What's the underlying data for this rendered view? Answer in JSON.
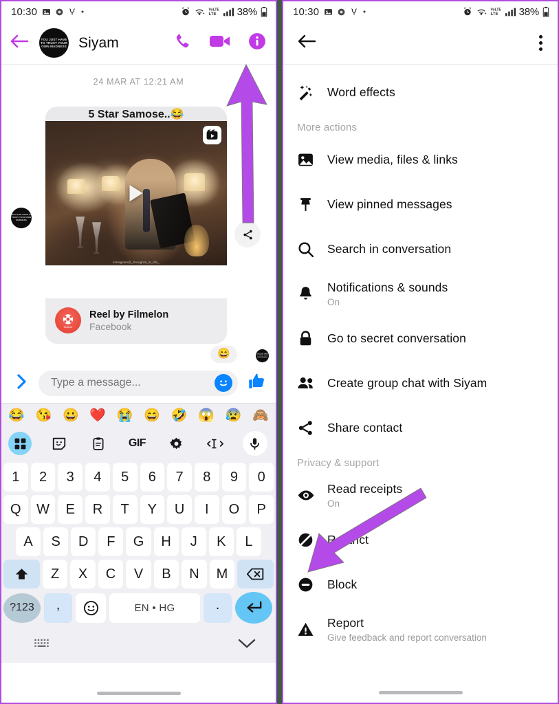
{
  "status_bar": {
    "time": "10:30",
    "battery_text": "38%",
    "network_label": "LTE",
    "volte_label": "VoLTE",
    "left_icons": [
      "photo-icon",
      "settings-gear-icon",
      "alarm-plug-icon",
      "dot-icon"
    ],
    "right_icons": [
      "alarm-clock-icon",
      "wifi-icon",
      "volte-icon",
      "signal-bars-icon",
      "battery-icon"
    ]
  },
  "left_panel": {
    "header": {
      "back_label": "Back",
      "contact_name": "Siyam",
      "avatar_text": "YOU JUST HAVE TO TRUST YOUR OWN MADNESS",
      "actions": [
        {
          "name": "audio-call-button",
          "icon": "phone-icon"
        },
        {
          "name": "video-call-button",
          "icon": "video-camera-icon"
        },
        {
          "name": "conversation-info-button",
          "icon": "info-icon"
        }
      ]
    },
    "conversation": {
      "timestamp": "24 MAR AT 12:21 AM",
      "message_caption": "5 Star Samose..",
      "message_caption_emoji": "😂",
      "media_credit": "instagram@_thoughts_in_life_",
      "reel_badge": "reel-icon",
      "attachment": {
        "title": "Reel by Filmelon",
        "subtitle": "Facebook",
        "logo_label": "filmelon"
      },
      "reaction_emoji": "😄",
      "share_icon": "share-icon"
    },
    "composer": {
      "expand_icon": "chevron-right-icon",
      "placeholder": "Type a message...",
      "value": "",
      "emoji_icon": "smiley-icon",
      "like_icon": "thumbs-up-icon"
    },
    "emoji_strip": [
      "😂",
      "😘",
      "😀",
      "❤️",
      "😭",
      "😄",
      "🤣",
      "😱",
      "😰",
      "🙈"
    ],
    "keyboard_toolbar": [
      {
        "name": "apps-grid-button",
        "icon": "grid-icon",
        "label": "",
        "active": true
      },
      {
        "name": "sticker-button",
        "icon": "sticker-icon",
        "label": ""
      },
      {
        "name": "clipboard-button",
        "icon": "clipboard-icon",
        "label": ""
      },
      {
        "name": "gif-button",
        "icon": "gif-icon",
        "label": "GIF"
      },
      {
        "name": "keyboard-settings-button",
        "icon": "gear-icon",
        "label": ""
      },
      {
        "name": "text-edit-button",
        "icon": "text-cursor-icon",
        "label": ""
      },
      {
        "name": "voice-input-button",
        "icon": "microphone-icon",
        "label": ""
      }
    ],
    "keyboard": {
      "row1": [
        "1",
        "2",
        "3",
        "4",
        "5",
        "6",
        "7",
        "8",
        "9",
        "0"
      ],
      "row2": [
        "Q",
        "W",
        "E",
        "R",
        "T",
        "Y",
        "U",
        "I",
        "O",
        "P"
      ],
      "row3": [
        "A",
        "S",
        "D",
        "F",
        "G",
        "H",
        "J",
        "K",
        "L"
      ],
      "row4": [
        "Z",
        "X",
        "C",
        "V",
        "B",
        "N",
        "M"
      ],
      "shift_icon": "shift-arrow-icon",
      "backspace_icon": "backspace-icon",
      "symbols_key": "?123",
      "comma_key": ",",
      "emoji_key": "☺",
      "space_key": "EN • HG",
      "period_key": ".",
      "enter_icon": "enter-arrow-icon",
      "switch_keyboard_icon": "keyboard-icon",
      "hide_keyboard_icon": "chevron-down-icon"
    }
  },
  "right_panel": {
    "header": {
      "back_icon": "back-arrow-icon",
      "overflow_icon": "kebab-menu-icon"
    },
    "top_items": [
      {
        "name": "word-effects",
        "icon": "magic-wand-icon",
        "label": "Word effects"
      }
    ],
    "sections": [
      {
        "title": "More actions",
        "items": [
          {
            "name": "view-media-files-links",
            "icon": "image-icon",
            "label": "View media, files & links"
          },
          {
            "name": "view-pinned-messages",
            "icon": "pin-icon",
            "label": "View pinned messages"
          },
          {
            "name": "search-in-conversation",
            "icon": "search-icon",
            "label": "Search in conversation"
          },
          {
            "name": "notifications-and-sounds",
            "icon": "bell-icon",
            "label": "Notifications & sounds",
            "sub": "On"
          },
          {
            "name": "go-to-secret-conversation",
            "icon": "lock-icon",
            "label": "Go to secret conversation"
          },
          {
            "name": "create-group-chat",
            "icon": "people-icon",
            "label": "Create group chat with Siyam"
          },
          {
            "name": "share-contact",
            "icon": "share-icon",
            "label": "Share contact"
          }
        ]
      },
      {
        "title": "Privacy & support",
        "items": [
          {
            "name": "read-receipts",
            "icon": "eye-icon",
            "label": "Read receipts",
            "sub": "On"
          },
          {
            "name": "restrict",
            "icon": "restrict-icon",
            "label": "Restrict"
          },
          {
            "name": "block",
            "icon": "block-icon",
            "label": "Block"
          },
          {
            "name": "report",
            "icon": "warning-icon",
            "label": "Report",
            "sub": "Give feedback and report conversation"
          }
        ]
      }
    ]
  },
  "annotations": {
    "arrow_color": "#b44ae8",
    "left_arrow_target": "conversation-info-button",
    "right_arrow_target": "restrict"
  },
  "theme": {
    "accent_purple": "#b44ae8",
    "messenger_blue": "#0a84ff",
    "frame_border": "#b04be0",
    "page_background": "#3f5c48"
  }
}
